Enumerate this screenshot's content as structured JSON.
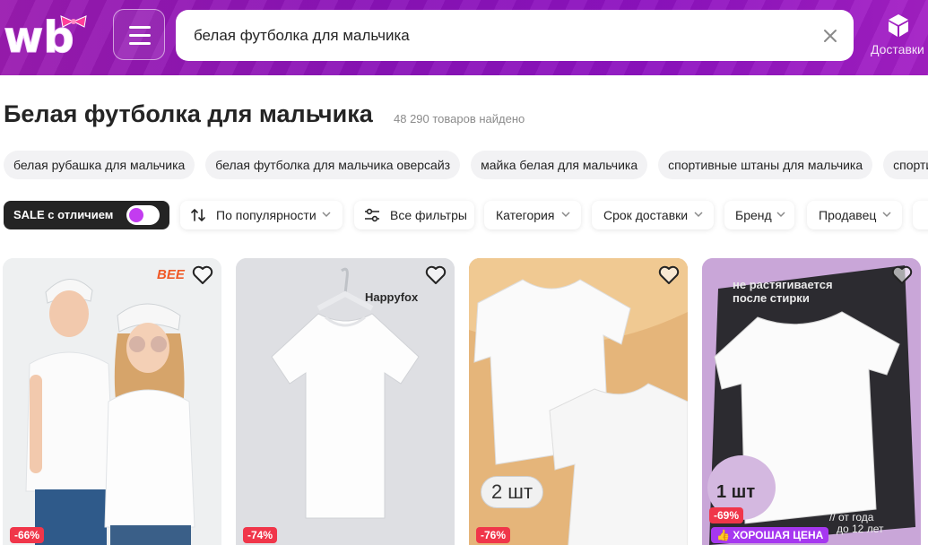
{
  "header": {
    "logo_text": "wb",
    "search_value": "белая футболка для мальчика",
    "delivery_label": "Доставки"
  },
  "page": {
    "title": "Белая футболка для мальчика",
    "count": "48 290 товаров найдено"
  },
  "suggestions": [
    "белая рубашка для мальчика",
    "белая футболка для мальчика оверсайз",
    "майка белая для мальчика",
    "спортивные штаны для мальчика",
    "спортив"
  ],
  "filters": {
    "sale_label": "SALE с отличием",
    "sort_label": "По популярности",
    "all_filters_label": "Все фильтры",
    "category_label": "Категория",
    "delivery_label": "Срок доставки",
    "brand_label": "Бренд",
    "seller_label": "Продавец"
  },
  "products": [
    {
      "brand_mark": "BEE",
      "discount": "-66%"
    },
    {
      "brand_mark": "Happyfox",
      "discount": "-74%"
    },
    {
      "discount": "-76%",
      "pack_label": "2 шт"
    },
    {
      "discount": "-69%",
      "pack_label": "1 шт",
      "promo_text_1": "не растягивается",
      "promo_text_2": "после стирки",
      "age_text_1": "// от года",
      "age_text_2": "до 12 лет",
      "good_price": "ХОРОШАЯ ЦЕНА"
    }
  ],
  "colors": {
    "brand_purple": "#8d12c0",
    "discount_red": "#f0364a",
    "toggle_accent": "#c33cf0",
    "good_price_purple": "#a637f0"
  }
}
